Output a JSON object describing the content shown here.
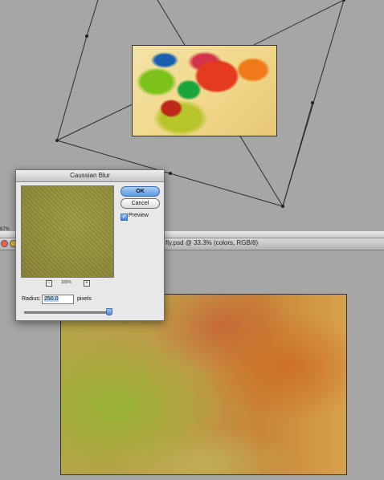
{
  "document": {
    "title": "fly.psd @ 33.3% (colors, RGB/8)",
    "secondary_zoom": "67%"
  },
  "dialog": {
    "title": "Caussian Blur",
    "ok_label": "OK",
    "cancel_label": "Cancel",
    "preview_label": "Preview",
    "preview_checked": true,
    "zoom_minus": "−",
    "zoom_value": "100%",
    "zoom_plus": "+",
    "radius_label": "Radius:",
    "radius_value": "250.0",
    "pixels_label": "pixels"
  },
  "colors": {
    "canvas_background": "#a6a6a6",
    "accent_blue": "#5b9ae0"
  },
  "icons": {
    "close": "close-icon",
    "minimize": "minimize-icon",
    "zoom": "zoom-icon"
  }
}
